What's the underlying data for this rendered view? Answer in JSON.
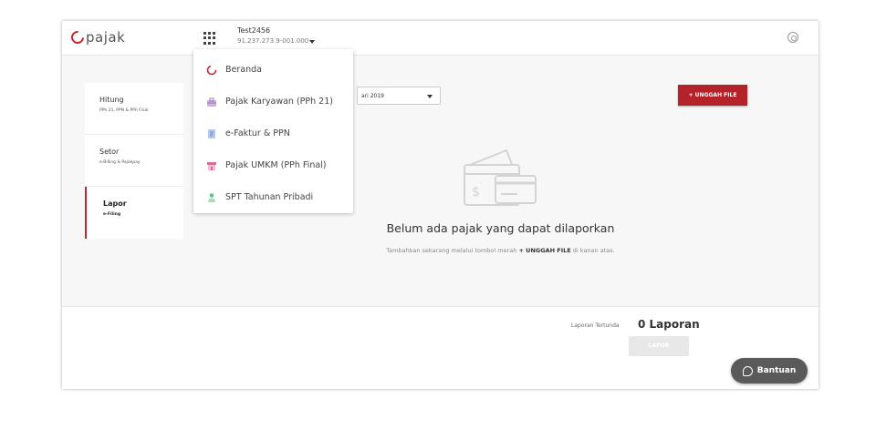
{
  "header": {
    "logo_text": "pajak",
    "company_name": "Test2456",
    "company_npwp": "91.237.273.9-001.000"
  },
  "sidenav": {
    "items": [
      {
        "title": "Hitung",
        "subtitle": "PPh 21, PPN & PPh Final",
        "active": false
      },
      {
        "title": "Setor",
        "subtitle": "e-Billing & Pajakpay",
        "active": false
      },
      {
        "title": "Lapor",
        "subtitle": "e-Filing",
        "active": true
      }
    ]
  },
  "filter": {
    "period_value": "ari 2019"
  },
  "toolbar": {
    "upload_label": "+ UNGGAH FILE"
  },
  "empty_state": {
    "title": "Belum ada pajak yang dapat dilaporkan",
    "hint_prefix": "Tambahkan sekarang melalui tombol merah ",
    "hint_bold": "+ UNGGAH FILE",
    "hint_suffix": " di kanan atas."
  },
  "footer": {
    "pending_label": "Laporan Tertunda",
    "pending_count": "0 Laporan",
    "lapor_label": "LAPOR"
  },
  "help": {
    "label": "Bantuan"
  },
  "app_menu": {
    "items": [
      {
        "label": "Beranda",
        "icon": "beranda-icon",
        "color": "#c0262d"
      },
      {
        "label": "Pajak Karyawan (PPh 21)",
        "icon": "employee-tax-icon",
        "color": "#9b7bb8"
      },
      {
        "label": "e-Faktur & PPN",
        "icon": "invoice-icon",
        "color": "#6b8fd6"
      },
      {
        "label": "Pajak UMKM (PPh Final)",
        "icon": "store-icon",
        "color": "#d66b9b"
      },
      {
        "label": "SPT Tahunan Pribadi",
        "icon": "person-icon",
        "color": "#6bbf8a"
      }
    ]
  },
  "colors": {
    "accent": "#b5232a",
    "help_button": "#5a5a5a"
  }
}
